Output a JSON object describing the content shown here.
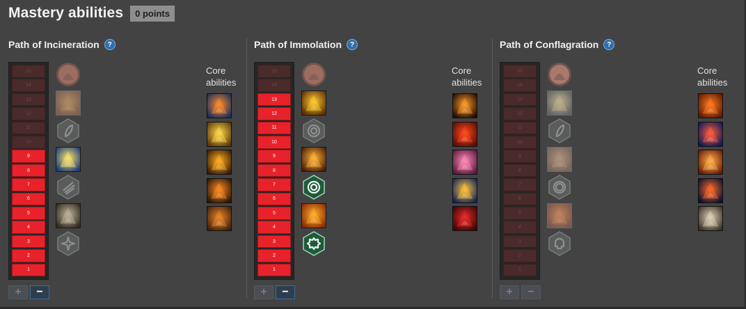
{
  "header": {
    "title": "Mastery abilities",
    "points_label": "0 points"
  },
  "help_glyph": "?",
  "core_label": "Core abilities",
  "buttons": {
    "plus": "+",
    "minus": "−"
  },
  "paths": [
    {
      "name": "Path of Incineration",
      "points": 9,
      "max": 15,
      "minus_enabled": true,
      "nodes": [
        {
          "icon": "fire-demon-face-icon",
          "kind": "round",
          "active": false
        },
        {
          "icon": "fire-spirit-icon",
          "kind": "square",
          "active": false
        },
        {
          "icon": "tactic-leaf-icon",
          "kind": "hex",
          "active": false
        },
        {
          "icon": "sun-burst-icon",
          "kind": "square",
          "active": true
        },
        {
          "icon": "tactic-wing-icon",
          "kind": "hex",
          "active": false
        },
        {
          "icon": "demon-mask-icon",
          "kind": "square",
          "active": true
        },
        {
          "icon": "tactic-star-icon",
          "kind": "hex",
          "active": false
        }
      ],
      "core": [
        {
          "icon": "comet-fireball-icon"
        },
        {
          "icon": "lightning-tree-icon"
        },
        {
          "icon": "flaming-sword-icon"
        },
        {
          "icon": "fire-pillar-icon"
        },
        {
          "icon": "burning-blade-icon"
        }
      ]
    },
    {
      "name": "Path of Immolation",
      "points": 13,
      "max": 15,
      "minus_enabled": true,
      "nodes": [
        {
          "icon": "fire-demon-face-icon",
          "kind": "round",
          "active": false
        },
        {
          "icon": "fire-serpent-icon",
          "kind": "square",
          "active": true
        },
        {
          "icon": "tactic-circle-icon",
          "kind": "hex",
          "active": false
        },
        {
          "icon": "fire-burst-icon",
          "kind": "square",
          "active": true
        },
        {
          "icon": "tactic-swirl-icon",
          "kind": "hex",
          "active": true
        },
        {
          "icon": "fire-face-icon",
          "kind": "square",
          "active": true
        },
        {
          "icon": "tactic-gear-icon",
          "kind": "hex",
          "active": true
        }
      ],
      "core": [
        {
          "icon": "burning-figure-icon"
        },
        {
          "icon": "fire-ring-icon"
        },
        {
          "icon": "flower-burst-icon"
        },
        {
          "icon": "shield-lock-icon"
        },
        {
          "icon": "red-hooded-figure-icon"
        }
      ]
    },
    {
      "name": "Path of Conflagration",
      "points": 0,
      "max": 15,
      "minus_enabled": false,
      "nodes": [
        {
          "icon": "fire-column-icon",
          "kind": "round",
          "active": false
        },
        {
          "icon": "flare-icon",
          "kind": "square",
          "active": false
        },
        {
          "icon": "tactic-leaf-icon",
          "kind": "hex",
          "active": false
        },
        {
          "icon": "fire-wisp-icon",
          "kind": "square",
          "active": false
        },
        {
          "icon": "tactic-ring-icon",
          "kind": "hex",
          "active": false
        },
        {
          "icon": "fire-wave-icon",
          "kind": "square",
          "active": false
        },
        {
          "icon": "tactic-skull-icon",
          "kind": "hex",
          "active": false
        }
      ],
      "core": [
        {
          "icon": "fire-wave-icon"
        },
        {
          "icon": "red-beam-icon"
        },
        {
          "icon": "fire-mage-icon"
        },
        {
          "icon": "falling-meteor-icon"
        },
        {
          "icon": "skeleton-icon"
        }
      ]
    }
  ],
  "colors": {
    "background": "#434343",
    "filled_segment": "#e8222b",
    "empty_segment": "#4a2a2a",
    "help_badge": "#2f6fa8",
    "points_badge": "#8e8e8e"
  }
}
